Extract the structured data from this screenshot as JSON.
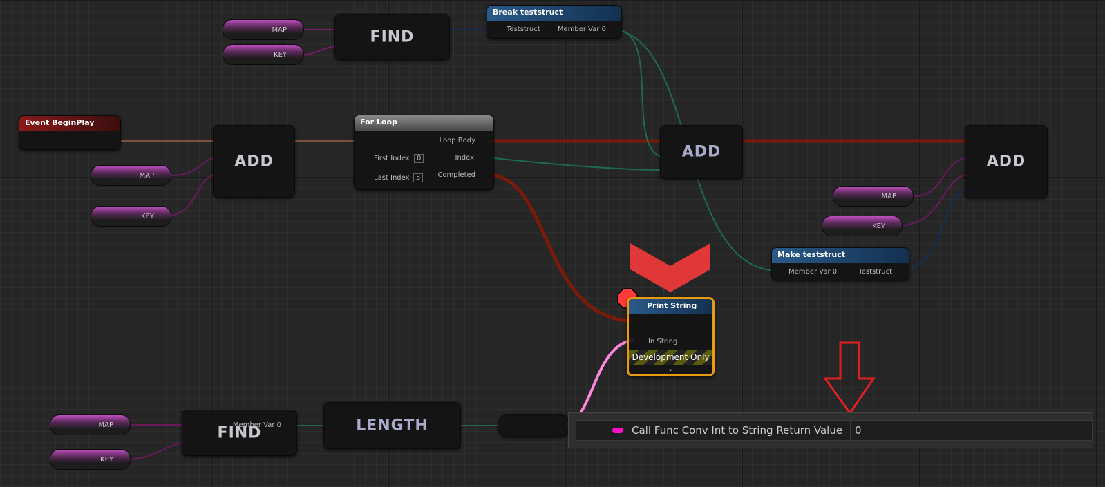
{
  "nodes": {
    "find_top": {
      "title": "FIND"
    },
    "break_struct": {
      "title": "Break teststruct",
      "pin_in": "Teststruct",
      "pin_out": "Member Var 0"
    },
    "event_begin": {
      "title": "Event BeginPlay"
    },
    "add_left": {
      "title": "ADD"
    },
    "for_loop": {
      "title": "For Loop",
      "loop_body": "Loop Body",
      "first_index": "First Index",
      "first_value": "0",
      "index": "Index",
      "last_index": "Last Index",
      "last_value": "5",
      "completed": "Completed"
    },
    "add_mid": {
      "title": "ADD"
    },
    "add_right": {
      "title": "ADD"
    },
    "make_struct": {
      "title": "Make teststruct",
      "pin_in": "Member Var 0",
      "pin_out": "Teststruct"
    },
    "print_string": {
      "title": "Print String",
      "in_string": "In String",
      "dev_only": "Development Only"
    },
    "find_bottom": {
      "title": "FIND",
      "pin_out": "Member Var 0"
    },
    "length": {
      "title": "LENGTH"
    }
  },
  "vars": {
    "map": "MAP",
    "key": "KEY"
  },
  "tooltip": {
    "label": "Call Func Conv Int to String Return Value",
    "value": "0"
  },
  "colors": {
    "exec_wire": "#8a1a0a",
    "struct_wire": "#1f6a55",
    "string_wire": "#ff88dd",
    "map_pin": "#1e6ee0",
    "key_pin": "#b0108a",
    "annotation": "#e02020"
  }
}
